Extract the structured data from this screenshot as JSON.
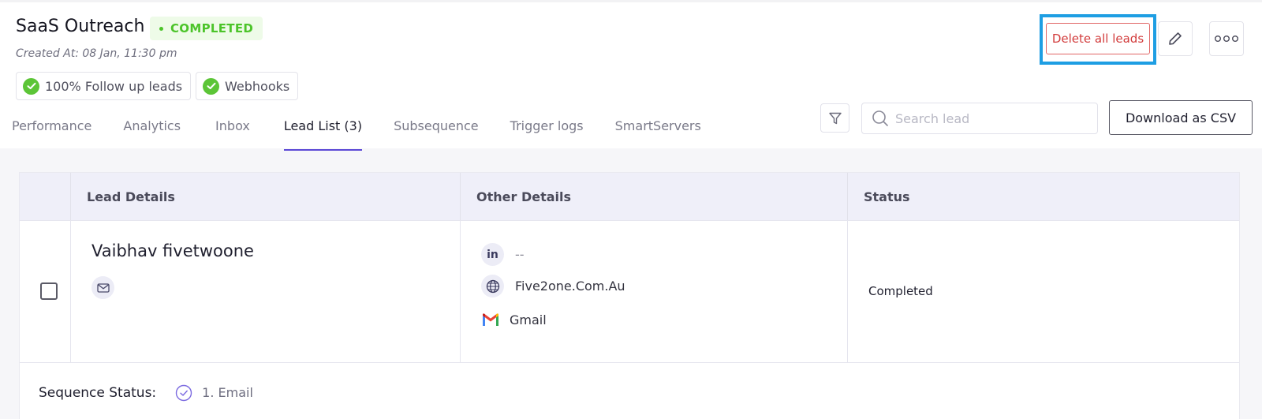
{
  "campaign": {
    "title": "SaaS Outreach",
    "status": "COMPLETED",
    "created_at": "Created At: 08 Jan, 11:30 pm"
  },
  "chips": [
    {
      "label": "100% Follow up leads",
      "icon": "check-circle-icon"
    },
    {
      "label": "Webhooks",
      "icon": "check-circle-icon"
    }
  ],
  "actions": {
    "delete_label": "Delete all leads",
    "download_label": "Download as CSV"
  },
  "search": {
    "placeholder": "Search lead"
  },
  "tabs": [
    {
      "label": "Performance"
    },
    {
      "label": "Analytics"
    },
    {
      "label": "Inbox"
    },
    {
      "label": "Lead List (3)",
      "active": true
    },
    {
      "label": "Subsequence"
    },
    {
      "label": "Trigger logs"
    },
    {
      "label": "SmartServers"
    }
  ],
  "table": {
    "headers": [
      "Lead Details",
      "Other Details",
      "Status"
    ],
    "rows": [
      {
        "name": "Vaibhav fivetwoone",
        "linkedin": "--",
        "website": "Five2one.Com.Au",
        "email_provider": "Gmail",
        "status": "Completed"
      }
    ],
    "sequence_label": "Sequence Status:",
    "sequence_step": "1. Email"
  },
  "colors": {
    "accent": "#5b48d6",
    "success": "#4cc42a",
    "danger": "#d23c3c",
    "highlight": "#1e9ee3"
  }
}
